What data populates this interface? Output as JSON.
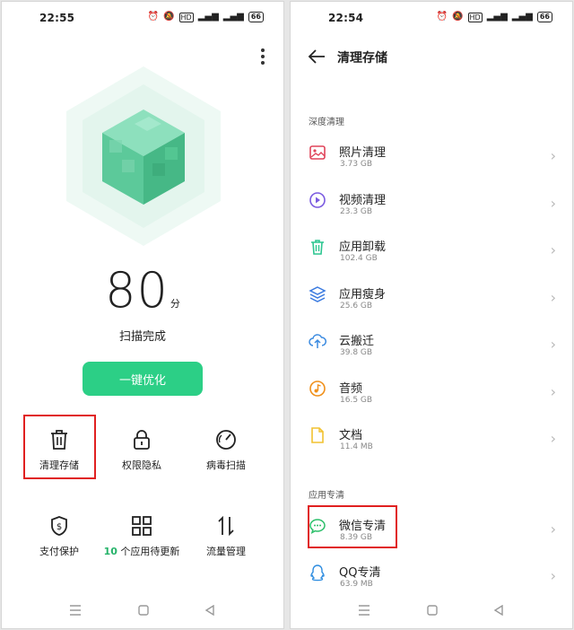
{
  "left": {
    "status": {
      "time": "22:55",
      "battery": "66"
    },
    "score": {
      "value": "80",
      "unit": "分"
    },
    "scan_status": "扫描完成",
    "optimize_button": "一键优化",
    "grid": [
      {
        "label": "清理存储",
        "icon": "trash-icon"
      },
      {
        "label": "权限隐私",
        "icon": "lock-icon"
      },
      {
        "label": "病毒扫描",
        "icon": "scan-gauge-icon"
      },
      {
        "label": "支付保护",
        "icon": "shield-dollar-icon"
      },
      {
        "count": "10",
        "label": "个应用待更新",
        "icon": "apps-grid-icon"
      },
      {
        "label": "流量管理",
        "icon": "data-arrows-icon"
      }
    ]
  },
  "right": {
    "status": {
      "time": "22:54",
      "battery": "66"
    },
    "title": "清理存储",
    "section_deep": "深度清理",
    "items": [
      {
        "name": "照片清理",
        "size": "3.73 GB",
        "icon": "photo-icon",
        "color": "#e0445a"
      },
      {
        "name": "视频清理",
        "size": "23.3 GB",
        "icon": "play-icon",
        "color": "#7a5ae0"
      },
      {
        "name": "应用卸载",
        "size": "102.4 GB",
        "icon": "trash-icon",
        "color": "#2cc690"
      },
      {
        "name": "应用瘦身",
        "size": "25.6 GB",
        "icon": "layers-icon",
        "color": "#3a7ae0"
      },
      {
        "name": "云搬迁",
        "size": "39.8 GB",
        "icon": "cloud-upload-icon",
        "color": "#3a8ae0"
      },
      {
        "name": "音频",
        "size": "16.5 GB",
        "icon": "music-icon",
        "color": "#f0901a"
      },
      {
        "name": "文档",
        "size": "11.4 MB",
        "icon": "document-icon",
        "color": "#f2c230"
      }
    ],
    "section_app": "应用专清",
    "app_items": [
      {
        "name": "微信专清",
        "size": "8.39 GB",
        "icon": "wechat-icon",
        "color": "#2cbf6a"
      },
      {
        "name": "QQ专清",
        "size": "63.9 MB",
        "icon": "qq-icon",
        "color": "#2f8de0"
      }
    ]
  }
}
